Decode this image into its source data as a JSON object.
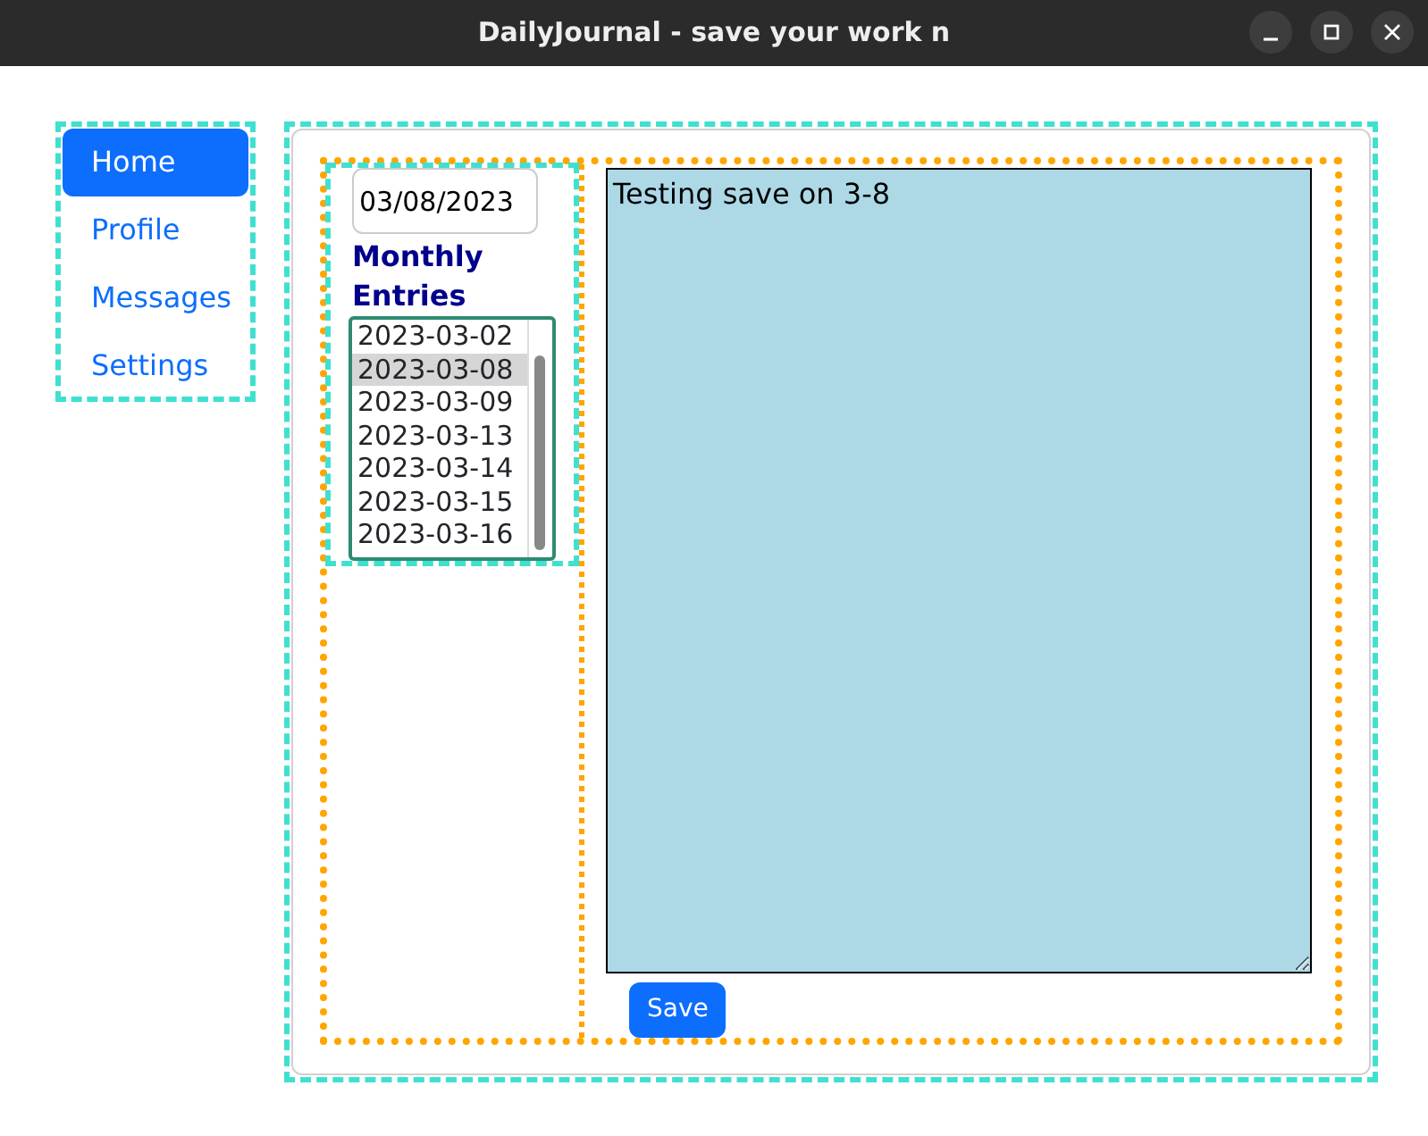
{
  "window": {
    "title": "DailyJournal - save your work n"
  },
  "nav": [
    {
      "label": "Home",
      "selected": true
    },
    {
      "label": "Profile",
      "selected": false
    },
    {
      "label": "Messages",
      "selected": false
    },
    {
      "label": "Settings",
      "selected": false
    }
  ],
  "date_field": {
    "value": "03/08/2023"
  },
  "entries": {
    "heading": "Monthly Entries",
    "items": [
      {
        "label": "2023-03-02",
        "selected": false
      },
      {
        "label": "2023-03-08",
        "selected": true
      },
      {
        "label": "2023-03-09",
        "selected": false
      },
      {
        "label": "2023-03-13",
        "selected": false
      },
      {
        "label": "2023-03-14",
        "selected": false
      },
      {
        "label": "2023-03-15",
        "selected": false
      },
      {
        "label": "2023-03-16",
        "selected": false
      }
    ]
  },
  "editor": {
    "value": "Testing save on 3-8"
  },
  "save_button": {
    "label": "Save"
  }
}
